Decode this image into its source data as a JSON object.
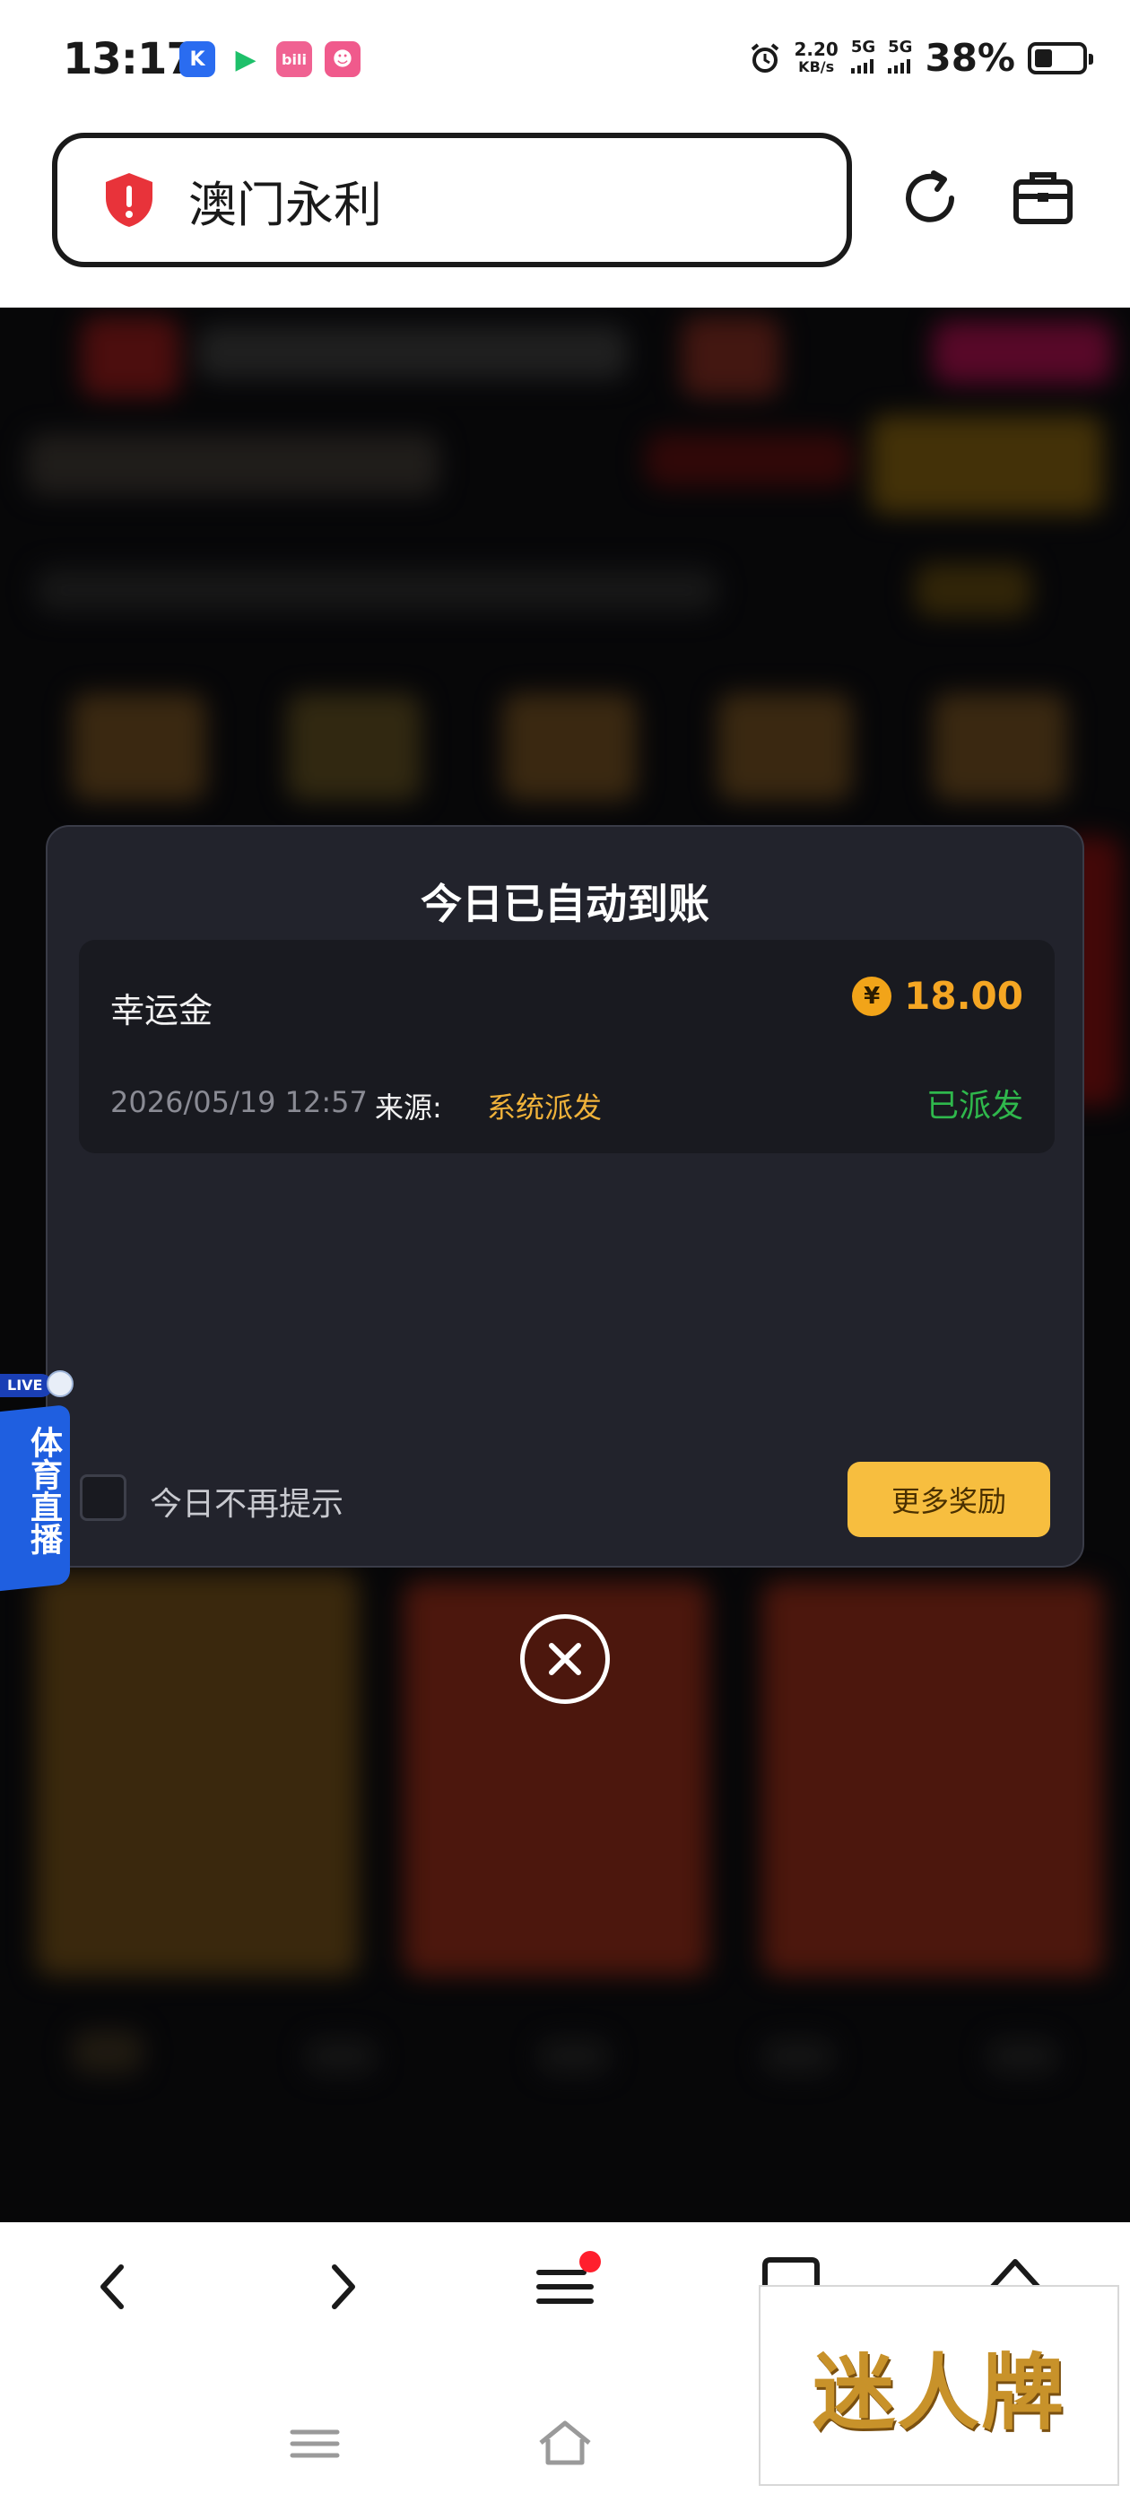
{
  "status_bar": {
    "time": "13:17",
    "apps": [
      {
        "name": "kuaishou-icon",
        "glyph": "K",
        "color": "#2a6cf0"
      },
      {
        "name": "video-icon",
        "glyph": "▶",
        "color": "#1ec06a"
      },
      {
        "name": "bilibili-icon",
        "glyph": "b",
        "color": "#f06292"
      },
      {
        "name": "frog-icon",
        "glyph": "☻",
        "color": "#f05a8c"
      }
    ],
    "speed_value": "2.20",
    "speed_unit": "KB/s",
    "net1": "5G",
    "net2": "5G",
    "battery_percent": "38%",
    "battery_level": 0.38
  },
  "browser": {
    "url_text": "澳门永利",
    "reload_label": "reload",
    "toolbox_label": "toolbox"
  },
  "modal": {
    "title": "今日已自动到账",
    "record": {
      "name": "幸运金",
      "currency_symbol": "¥",
      "amount": "18.00",
      "datetime": "2026/05/19 12:57",
      "source_label": "来源:",
      "source_value": "系统派发",
      "status": "已派发"
    },
    "no_remind_label": "今日不再提示",
    "more_button": "更多奖励"
  },
  "side_badge": {
    "live_tag": "LIVE",
    "text": "体育直播"
  },
  "watermark": {
    "text": "迷人牌"
  },
  "colors": {
    "accent_gold": "#f5a623",
    "status_green": "#2fb84c",
    "modal_bg": "#22232c",
    "button_yellow": "#f7be3f"
  }
}
